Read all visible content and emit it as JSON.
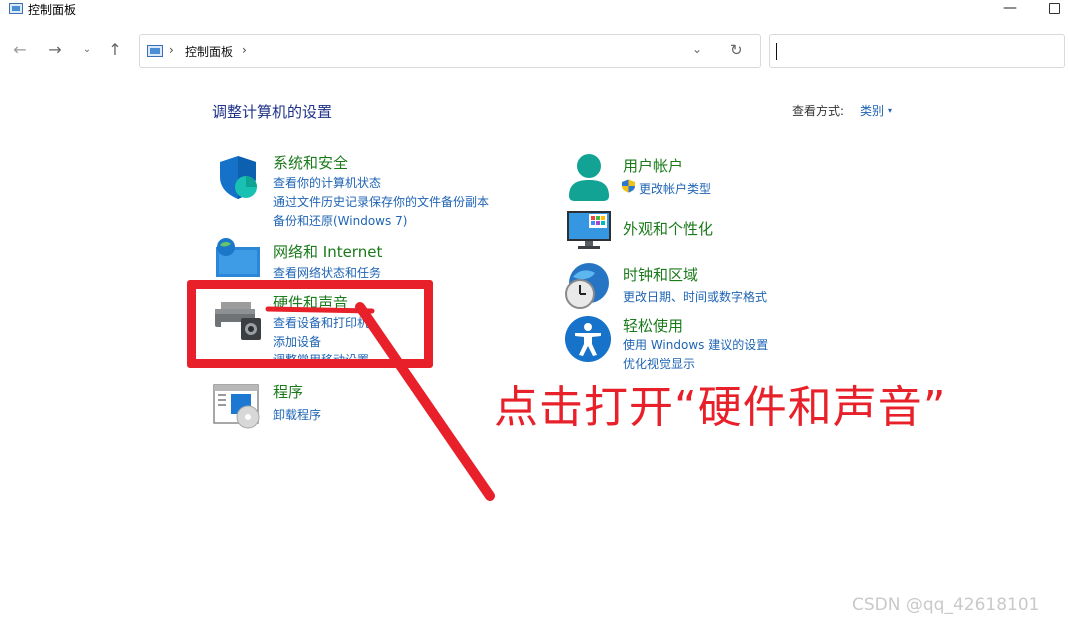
{
  "window": {
    "title": "控制面板",
    "minimize_glyph": "—"
  },
  "nav": {
    "back_glyph": "←",
    "forward_glyph": "→",
    "recent_glyph": "⌄",
    "up_glyph": "↑",
    "address": {
      "crumb": "控制面板",
      "separator": "›",
      "dropdown_glyph": "⌄",
      "refresh_glyph": "↻"
    },
    "search": {
      "value": ""
    }
  },
  "content": {
    "page_title": "调整计算机的设置",
    "view_by": {
      "label": "查看方式:",
      "value": "类别",
      "caret": "▾"
    },
    "left_categories": [
      {
        "title": "系统和安全",
        "icon": "shield-icon",
        "links": [
          "查看你的计算机状态",
          "通过文件历史记录保存你的文件备份副本",
          "备份和还原(Windows 7)"
        ]
      },
      {
        "title": "网络和 Internet",
        "icon": "globe-network-icon",
        "links": [
          "查看网络状态和任务"
        ]
      },
      {
        "title": "硬件和声音",
        "icon": "printer-icon",
        "links": [
          "查看设备和打印机",
          "添加设备",
          "调整常用移动设置"
        ]
      },
      {
        "title": "程序",
        "icon": "program-disc-icon",
        "links": [
          "卸载程序"
        ]
      }
    ],
    "right_categories": [
      {
        "title": "用户帐户",
        "icon": "user-icon",
        "links": [
          "更改帐户类型"
        ]
      },
      {
        "title": "外观和个性化",
        "icon": "monitor-icon",
        "links": []
      },
      {
        "title": "时钟和区域",
        "icon": "clock-globe-icon",
        "links": [
          "更改日期、时间或数字格式"
        ]
      },
      {
        "title": "轻松使用",
        "icon": "accessibility-icon",
        "links": [
          "使用 Windows 建议的设置",
          "优化视觉显示"
        ]
      }
    ]
  },
  "annotation": {
    "text": "点击打开“硬件和声音”",
    "color": "#e8202a"
  },
  "watermark": "CSDN @qq_42618101",
  "colors": {
    "category_title": "#1a7a1a",
    "link": "#1e64b4",
    "heading": "#1e3287"
  }
}
